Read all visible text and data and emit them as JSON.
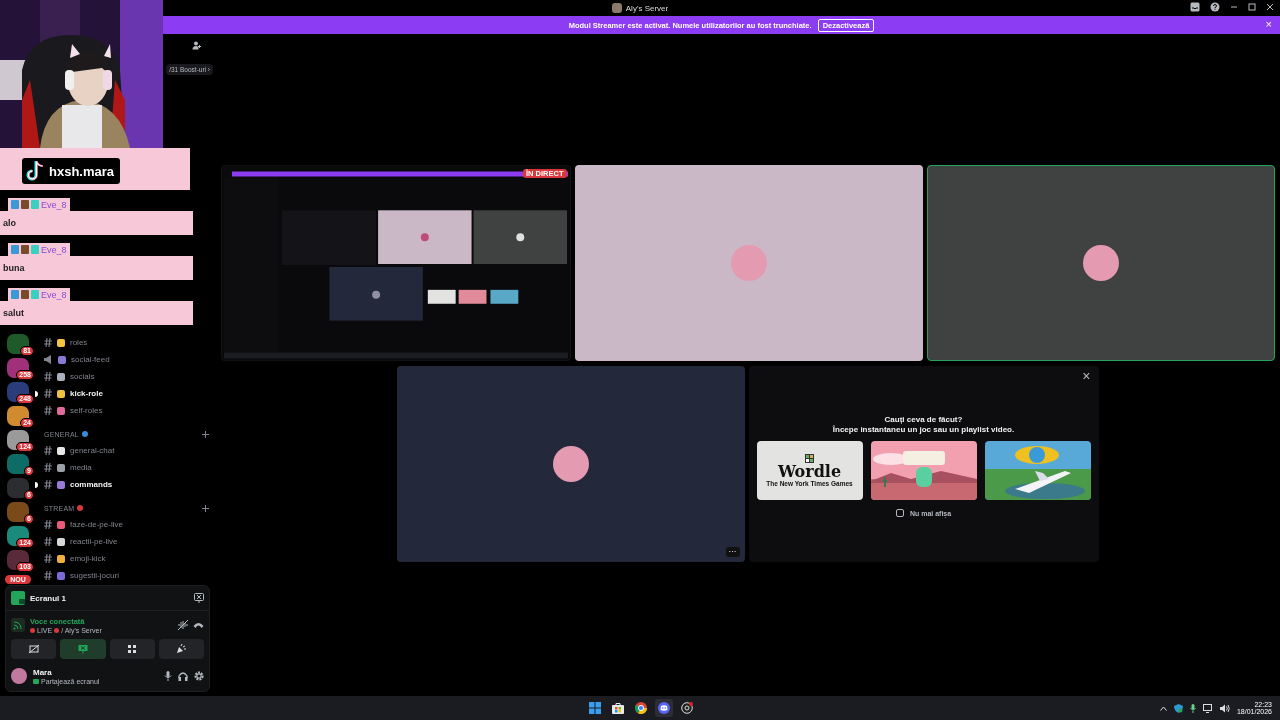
{
  "window": {
    "title": "Aly's Server"
  },
  "banner": {
    "text": "Modul Streamer este activat. Numele utilizatorilor au fost trunchiate.",
    "button": "Dezactivează",
    "close": "×"
  },
  "overlay": {
    "channel": "hxsh.mara",
    "messages": [
      {
        "user": "Eve_8",
        "text": "alo"
      },
      {
        "user": "Eve_8",
        "text": "buna"
      },
      {
        "user": "Eve_8",
        "text": "salut"
      }
    ]
  },
  "sidebar": {
    "boost": "/31 Boost-uri ›",
    "servers": [
      {
        "badge": "81",
        "color": "#1f5a2a"
      },
      {
        "badge": "258",
        "color": "#a0307a"
      },
      {
        "badge": "248",
        "color": "#2a3d7a"
      },
      {
        "badge": "24",
        "color": "#d08a30"
      },
      {
        "badge": "124",
        "color": "#9a9a9a"
      },
      {
        "badge": "9",
        "color": "#0d6d66"
      },
      {
        "badge": "6",
        "color": "#2b2d31"
      },
      {
        "badge": "6",
        "color": "#7a4a1a"
      },
      {
        "badge": "124",
        "color": "#1a8a7a"
      },
      {
        "badge": "103",
        "color": "#5a2a3a"
      }
    ],
    "new_label": "NOU",
    "groups": [
      {
        "channels": [
          {
            "name": "roles",
            "kind": "text",
            "unread": false
          },
          {
            "name": "social-feed",
            "kind": "announcement",
            "unread": false
          },
          {
            "name": "socials",
            "kind": "text",
            "unread": false
          },
          {
            "name": "kick-role",
            "kind": "text",
            "unread": true
          },
          {
            "name": "self-roles",
            "kind": "text",
            "unread": false
          }
        ]
      },
      {
        "category": "GENERAL",
        "channels": [
          {
            "name": "general-chat",
            "kind": "text",
            "unread": false
          },
          {
            "name": "media",
            "kind": "text",
            "unread": false
          },
          {
            "name": "commands",
            "kind": "text",
            "unread": true
          }
        ]
      },
      {
        "category": "STREAM",
        "channels": [
          {
            "name": "faze-de-pe-live",
            "kind": "text",
            "unread": false
          },
          {
            "name": "reactii-pe-live",
            "kind": "text",
            "unread": false
          },
          {
            "name": "emoji-kick",
            "kind": "text",
            "unread": false
          },
          {
            "name": "sugestii-jocuri",
            "kind": "text",
            "unread": false
          }
        ]
      }
    ]
  },
  "panel": {
    "screen": "Ecranul 1",
    "voice_status": "Voce conectată",
    "voice_channel": "LIVE",
    "voice_server": "/ Aly's Server",
    "buttons": [
      {
        "selected": false
      },
      {
        "selected": true
      },
      {
        "selected": false
      },
      {
        "selected": false
      }
    ],
    "user": {
      "name": "Mara",
      "status": "Partajează ecranul"
    }
  },
  "tiles": [
    {
      "kind": "screen",
      "badge": "ÎN DIRECT",
      "speaking": false
    },
    {
      "kind": "avatar",
      "color": "#cbb8c6",
      "speaking": false
    },
    {
      "kind": "avatar",
      "color": "#3f4241",
      "speaking": true
    },
    {
      "kind": "avatar",
      "color": "#23283a",
      "speaking": false,
      "menu": "···"
    }
  ],
  "activity": {
    "title": "Cauți ceva de făcut?",
    "subtitle": "Începe instantaneu un joc sau un playlist video.",
    "close": "×",
    "games": [
      {
        "kind": "wordle",
        "title": "Wordle",
        "subtitle": "The New York Times Games"
      },
      {
        "kind": "blazing"
      },
      {
        "kind": "airport"
      }
    ],
    "checkbox": {
      "label": "Nu mai afișa",
      "checked": false
    }
  },
  "taskbar": {
    "time": "22:23",
    "date": "18/01/2026"
  }
}
